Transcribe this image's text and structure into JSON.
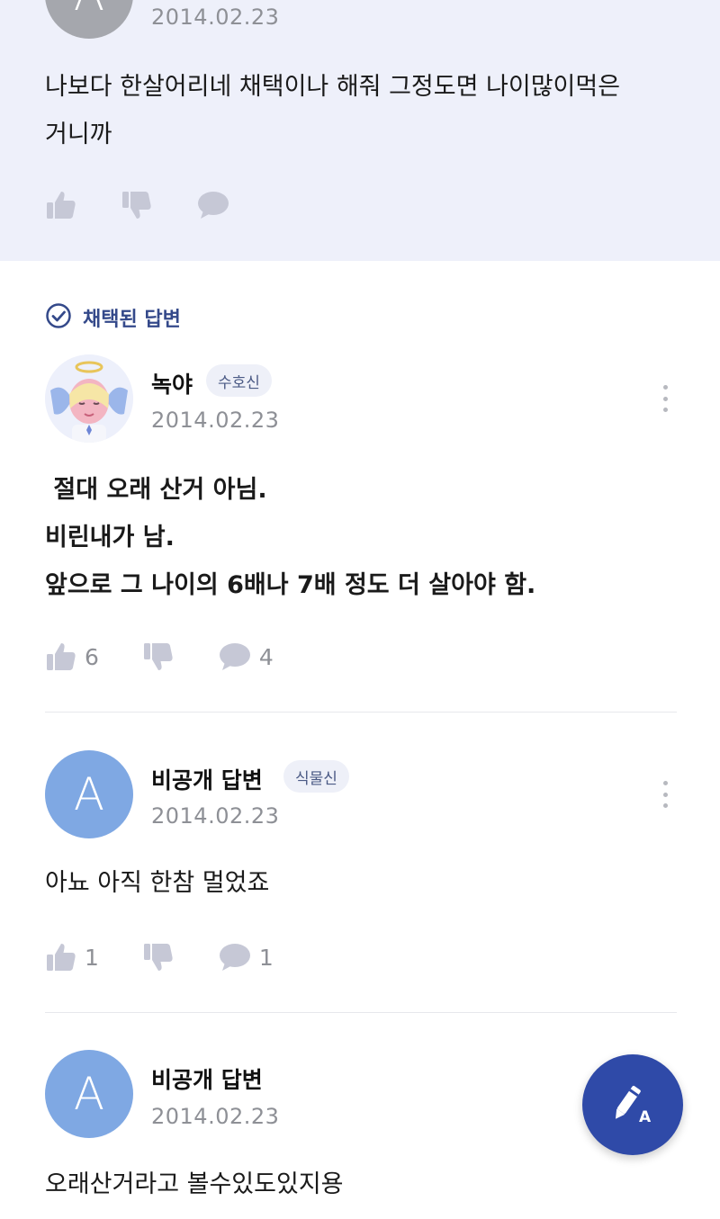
{
  "previous_answer": {
    "avatar_letter": "A",
    "date": "2014.02.23",
    "line1": "나보다 한살어리네 채택이나 해줘 그정도면 나이많이먹은",
    "line2": "거니까"
  },
  "adopted_answer": {
    "section_label": "채택된 답변",
    "author": "녹야",
    "badge": "수호신",
    "date": "2014.02.23",
    "lines": [
      " 절대 오래 산거 아님.",
      "비린내가 남.",
      "앞으로 그 나이의 6배나 7배 정도 더 살아야 함."
    ],
    "likes": "6",
    "comments": "4"
  },
  "answer2": {
    "avatar_letter": "A",
    "author": "비공개 답변",
    "badge": "식물신",
    "date": "2014.02.23",
    "text": "아뇨 아직 한참 멀었죠",
    "likes": "1",
    "comments": "1"
  },
  "answer3": {
    "avatar_letter": "A",
    "author": "비공개 답변",
    "date": "2014.02.23",
    "text": "오래산거라고 볼수있도있지용"
  },
  "colors": {
    "accent": "#2f4aa8",
    "top_block_bg": "#eef0fa",
    "avatar_blue": "#7fa8e3"
  },
  "icons": {
    "like": "thumbs-up-icon",
    "dislike": "thumbs-down-icon",
    "comment": "speech-bubble-icon",
    "more": "more-vertical-icon",
    "check": "check-circle-icon",
    "fab": "pen-a-icon"
  }
}
